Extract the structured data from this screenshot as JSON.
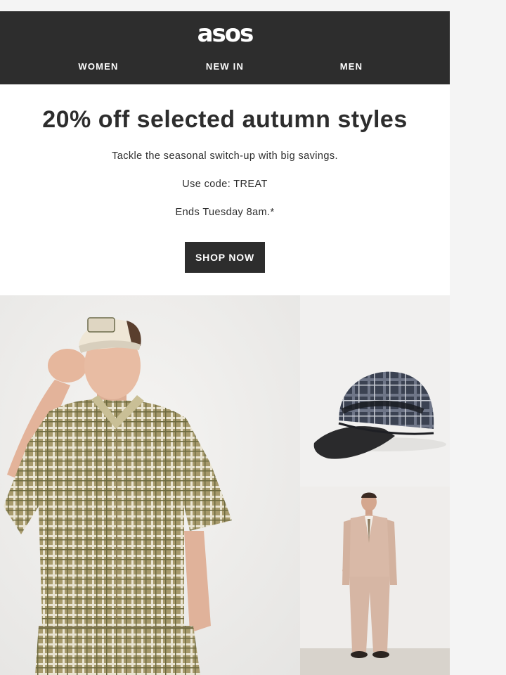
{
  "header": {
    "logo": "asos",
    "nav": [
      {
        "label": "WOMEN"
      },
      {
        "label": "NEW IN"
      },
      {
        "label": "MEN"
      }
    ]
  },
  "promo": {
    "title": "20% off selected autumn styles",
    "subtitle": "Tackle the seasonal switch-up with big savings.",
    "code_line": "Use code: TREAT",
    "ends_line": "Ends Tuesday 8am.*",
    "cta_label": "SHOP NOW"
  },
  "colors": {
    "header_bg": "#2d2d2d",
    "text": "#2d2d2d",
    "button_bg": "#2d2d2d",
    "page_bg": "#f4f4f4"
  }
}
